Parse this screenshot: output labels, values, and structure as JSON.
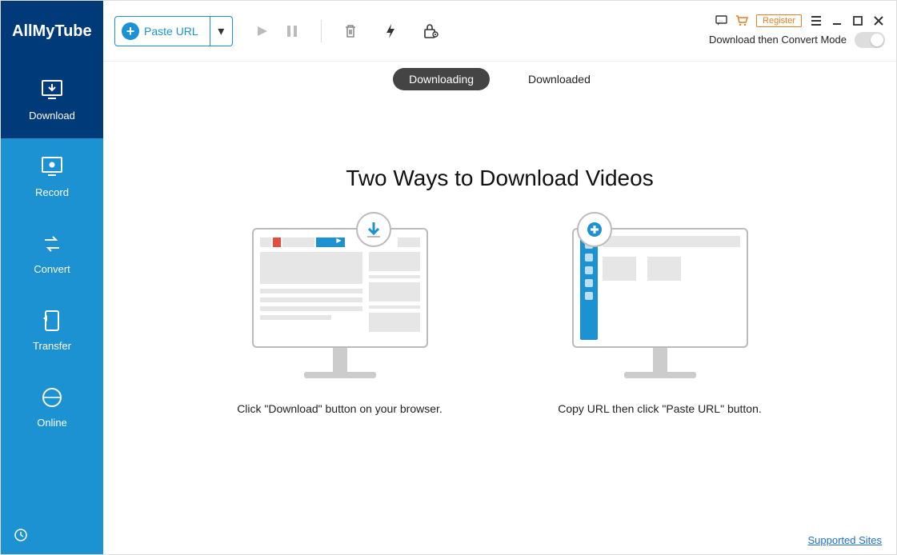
{
  "app": {
    "name": "AllMyTube"
  },
  "sidebar": {
    "items": [
      {
        "label": "Download"
      },
      {
        "label": "Record"
      },
      {
        "label": "Convert"
      },
      {
        "label": "Transfer"
      },
      {
        "label": "Online"
      }
    ]
  },
  "toolbar": {
    "paste_label": "Paste URL"
  },
  "header": {
    "register_label": "Register",
    "mode_label": "Download then Convert Mode"
  },
  "tabs": {
    "downloading": "Downloading",
    "downloaded": "Downloaded"
  },
  "content": {
    "headline": "Two Ways to Download Videos",
    "card1_caption": "Click \"Download\" button on your browser.",
    "card2_caption": "Copy URL then click \"Paste URL\" button."
  },
  "footer": {
    "supported_sites": "Supported Sites"
  }
}
